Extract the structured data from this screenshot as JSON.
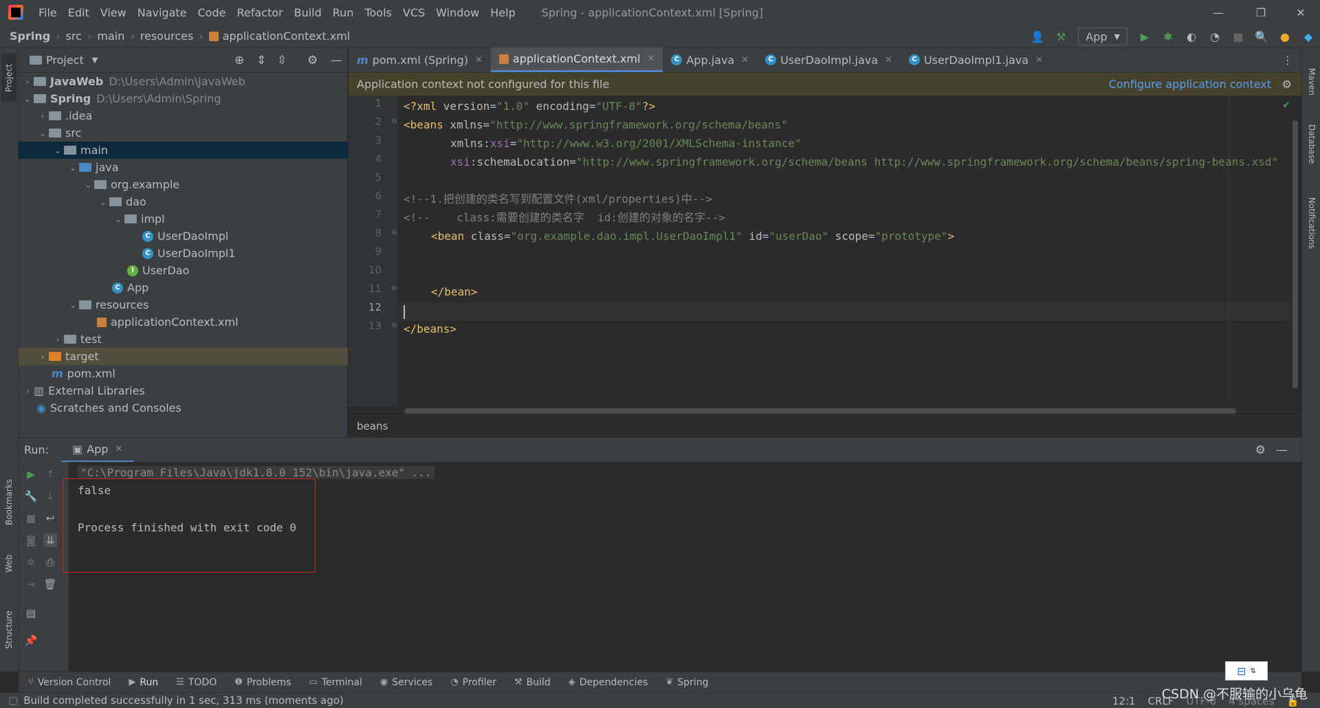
{
  "window": {
    "title": "Spring - applicationContext.xml [Spring]",
    "menu": [
      "File",
      "Edit",
      "View",
      "Navigate",
      "Code",
      "Refactor",
      "Build",
      "Run",
      "Tools",
      "VCS",
      "Window",
      "Help"
    ],
    "minimize": "—",
    "restore": "❐",
    "close": "✕"
  },
  "navbar": {
    "crumbs": [
      "Spring",
      "src",
      "main",
      "resources",
      "applicationContext.xml"
    ],
    "run_config": "App"
  },
  "left_strip": {
    "project": "Project",
    "bookmarks": "Bookmarks",
    "web": "Web",
    "structure": "Structure"
  },
  "right_strip": {
    "maven": "Maven",
    "database": "Database",
    "notifications": "Notifications"
  },
  "project_panel": {
    "title": "Project",
    "tree": [
      {
        "label": "JavaWeb",
        "path": "D:\\Users\\Admin\\JavaWeb"
      },
      {
        "label": "Spring",
        "path": "D:\\Users\\Admin\\Spring"
      },
      {
        "label": ".idea"
      },
      {
        "label": "src"
      },
      {
        "label": "main"
      },
      {
        "label": "java"
      },
      {
        "label": "org.example"
      },
      {
        "label": "dao"
      },
      {
        "label": "impl"
      },
      {
        "label": "UserDaoImpl"
      },
      {
        "label": "UserDaoImpl1"
      },
      {
        "label": "UserDao"
      },
      {
        "label": "App"
      },
      {
        "label": "resources"
      },
      {
        "label": "applicationContext.xml"
      },
      {
        "label": "test"
      },
      {
        "label": "target"
      },
      {
        "label": "pom.xml"
      },
      {
        "label": "External Libraries"
      },
      {
        "label": "Scratches and Consoles"
      }
    ]
  },
  "editor": {
    "tabs": [
      "pom.xml (Spring)",
      "applicationContext.xml",
      "App.java",
      "UserDaoImpl.java",
      "UserDaoImpl1.java"
    ],
    "banner": "Application context not configured for this file",
    "banner_link": "Configure application context",
    "line_numbers": [
      "1",
      "2",
      "3",
      "4",
      "5",
      "6",
      "7",
      "8",
      "9",
      "10",
      "11",
      "12",
      "13"
    ],
    "code": {
      "l1_a": "<?xml ",
      "l1_b": "version",
      "l1_c": "=",
      "l1_d": "\"1.0\"",
      "l1_e": " encoding",
      "l1_f": "=",
      "l1_g": "\"UTF-8\"",
      "l1_h": "?>",
      "l2_a": "<beans ",
      "l2_b": "xmlns",
      "l2_c": "=",
      "l2_d": "\"http://www.springframework.org/schema/beans\"",
      "l3_a": "xmlns:",
      "l3_b": "xsi",
      "l3_c": "=",
      "l3_d": "\"http://www.w3.org/2001/XMLSchema-instance\"",
      "l4_a": "xsi",
      "l4_b": ":schemaLocation",
      "l4_c": "=",
      "l4_d": "\"http://www.springframework.org/schema/beans http://www.springframework.org/schema/beans/spring-beans.xsd\"",
      "l6": "<!--1.把创建的类名写到配置文件(xml/properties)中-->",
      "l7": "<!--    class:需要创建的类名字  id:创建的对象的名字-->",
      "l8_a": "<bean ",
      "l8_b": "class",
      "l8_c": "=",
      "l8_d": "\"org.example.dao.impl.UserDaoImpl1\"",
      "l8_e": " id",
      "l8_f": "=",
      "l8_g": "\"userDao\"",
      "l8_h": " scope",
      "l8_i": "=",
      "l8_j": "\"prototype\"",
      "l8_k": ">",
      "l11": "</bean>",
      "l13": "</beans>"
    },
    "breadcrumb": "beans"
  },
  "run_panel": {
    "label": "Run:",
    "tab": "App",
    "console": [
      "\"C:\\Program Files\\Java\\jdk1.8.0_152\\bin\\java.exe\" ...",
      "false",
      "",
      "Process finished with exit code 0"
    ]
  },
  "bottom_tabs": [
    "Version Control",
    "Run",
    "TODO",
    "Problems",
    "Terminal",
    "Services",
    "Profiler",
    "Build",
    "Dependencies",
    "Spring"
  ],
  "statusbar": {
    "message": "Build completed successfully in 1 sec, 313 ms (moments ago)",
    "position": "12:1",
    "line_sep": "CRLF",
    "encoding": "UTF-8",
    "indent": "4 spaces"
  },
  "watermark": "CSDN @不服输的小乌龟",
  "colors": {
    "accent": "#4a88c7",
    "selection": "#0d293e",
    "highlight": "#524d3c",
    "tag": "#e8bf6a",
    "string": "#6a8759",
    "comment": "#808080",
    "error_box": "#c52b2b"
  }
}
